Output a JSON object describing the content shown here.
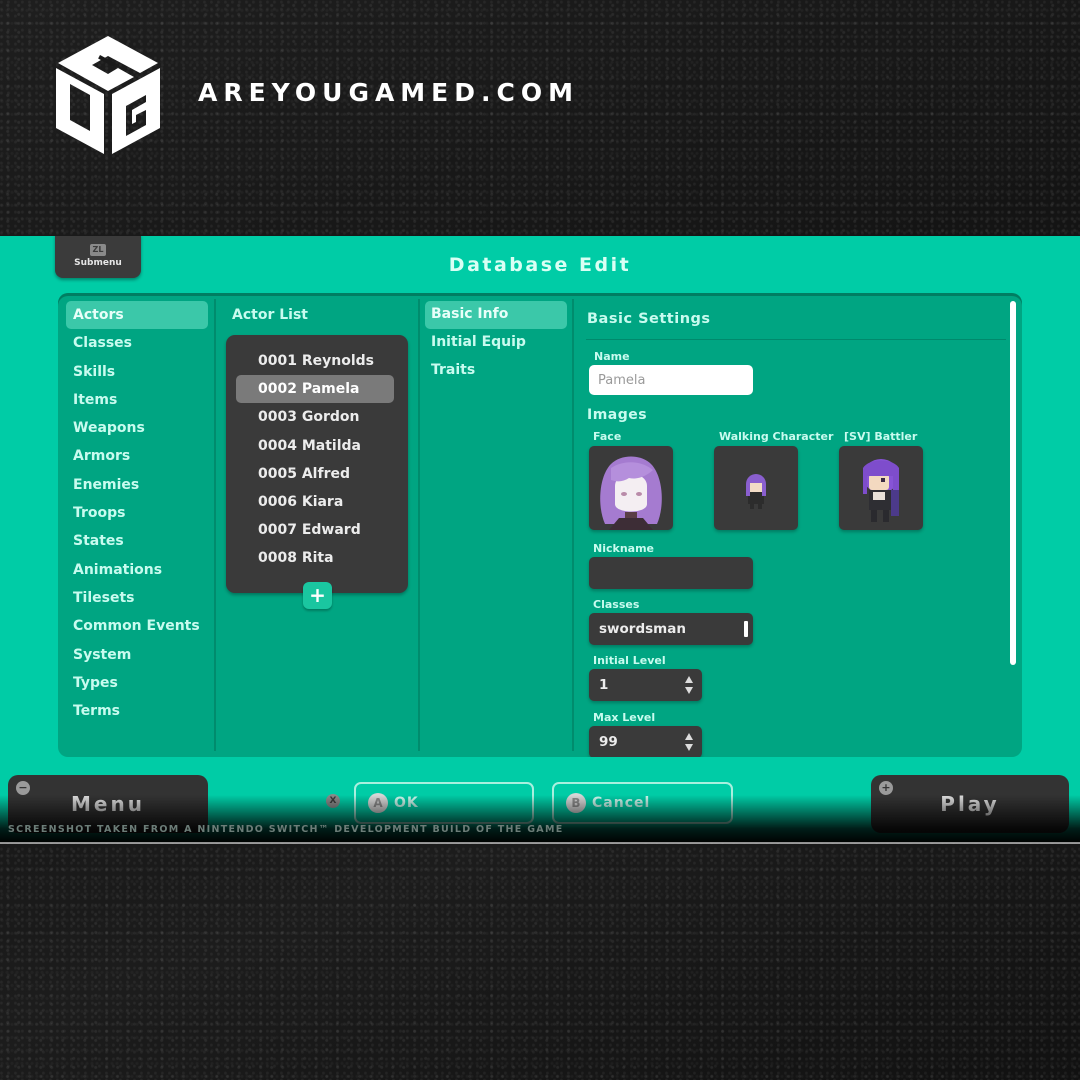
{
  "brand": {
    "site": "AREYOUGAMED.COM",
    "logo_letters": [
      "A",
      "Y",
      "G"
    ],
    "logo_icon": "cube-logo-icon"
  },
  "screen": {
    "title": "Database Edit",
    "submenu": {
      "key": "ZL",
      "label": "Submenu"
    },
    "categories": [
      {
        "label": "Actors",
        "active": true
      },
      {
        "label": "Classes"
      },
      {
        "label": "Skills"
      },
      {
        "label": "Items"
      },
      {
        "label": "Weapons"
      },
      {
        "label": "Armors"
      },
      {
        "label": "Enemies"
      },
      {
        "label": "Troops"
      },
      {
        "label": "States"
      },
      {
        "label": "Animations"
      },
      {
        "label": "Tilesets"
      },
      {
        "label": "Common Events"
      },
      {
        "label": "System"
      },
      {
        "label": "Types"
      },
      {
        "label": "Terms"
      }
    ],
    "actor_list": {
      "heading": "Actor List",
      "items": [
        {
          "label": "0001 Reynolds"
        },
        {
          "label": "0002 Pamela",
          "selected": true
        },
        {
          "label": "0003 Gordon"
        },
        {
          "label": "0004 Matilda"
        },
        {
          "label": "0005 Alfred"
        },
        {
          "label": "0006 Kiara"
        },
        {
          "label": "0007 Edward"
        },
        {
          "label": "0008 Rita"
        }
      ],
      "add_icon": "+"
    },
    "tabs": [
      {
        "label": "Basic Info",
        "active": true
      },
      {
        "label": "Initial Equip"
      },
      {
        "label": "Traits"
      }
    ],
    "form": {
      "section": "Basic Settings",
      "name_label": "Name",
      "name_value": "Pamela",
      "images_label": "Images",
      "face_label": "Face",
      "walking_label": "Walking Character",
      "battler_label": "[SV] Battler",
      "nickname_label": "Nickname",
      "nickname_value": "",
      "classes_label": "Classes",
      "classes_value": "swordsman",
      "initial_level_label": "Initial Level",
      "initial_level_value": "1",
      "max_level_label": "Max Level",
      "max_level_value": "99"
    },
    "bottom": {
      "menu_label": "Menu",
      "menu_key": "−",
      "x_key": "X",
      "ok_key": "A",
      "ok_label": "OK",
      "cancel_key": "B",
      "cancel_label": "Cancel",
      "play_key": "+",
      "play_label": "Play",
      "disclaimer": "SCREENSHOT TAKEN FROM A NINTENDO SWITCH™ DEVELOPMENT BUILD OF THE GAME"
    },
    "colors": {
      "accent": "#00cca6",
      "panel": "#00a582",
      "dark": "#3a3a3a",
      "highlight": "#3bc8a9"
    }
  }
}
